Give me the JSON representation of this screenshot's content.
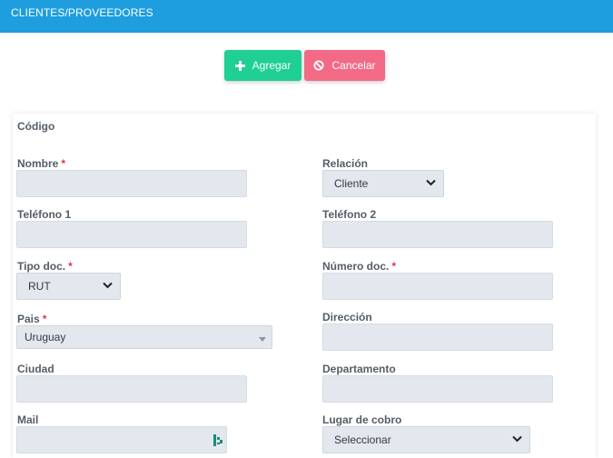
{
  "header": {
    "title": "CLIENTES/PROVEEDORES"
  },
  "actions": {
    "add_label": "Agregar",
    "cancel_label": "Cancelar"
  },
  "form": {
    "codigo_label": "Código",
    "nombre_label": "Nombre",
    "relacion_label": "Relación",
    "relacion_value": "Cliente",
    "telefono1_label": "Teléfono 1",
    "telefono2_label": "Teléfono 2",
    "tipodoc_label": "Tipo doc.",
    "tipodoc_value": "RUT",
    "numerodoc_label": "Número doc.",
    "pais_label": "Pais",
    "pais_value": "Uruguay",
    "direccion_label": "Dirección",
    "ciudad_label": "Ciudad",
    "departamento_label": "Departamento",
    "mail_label": "Mail",
    "lugarcobro_label": "Lugar de cobro",
    "lugarcobro_value": "Seleccionar",
    "required_mark": "*"
  },
  "colors": {
    "header": "#1e9ede",
    "add": "#1fcf93",
    "cancel": "#f36a86",
    "required": "#e0354d"
  },
  "icons": {
    "add": "plus-icon",
    "cancel": "ban-icon",
    "select": "chevron-down-icon",
    "password_manager": "password-manager-icon"
  }
}
